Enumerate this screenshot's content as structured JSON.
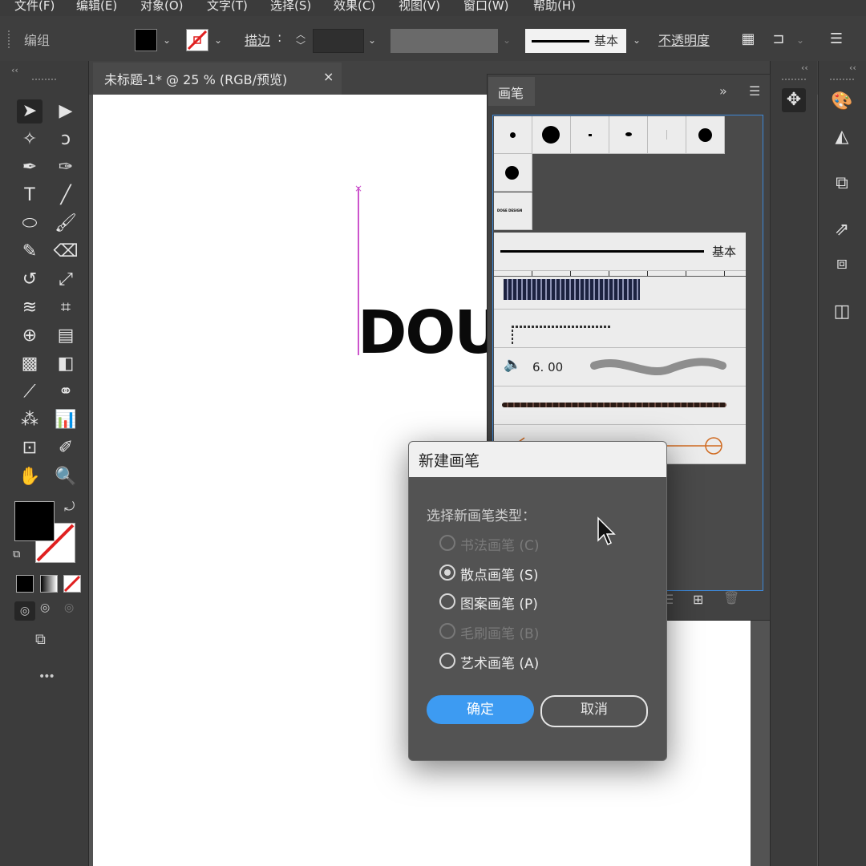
{
  "menu": [
    "文件(F)",
    "编辑(E)",
    "对象(O)",
    "文字(T)",
    "选择(S)",
    "效果(C)",
    "视图(V)",
    "窗口(W)",
    "帮助(H)"
  ],
  "control_bar": {
    "group_label": "编组",
    "stroke_label": "描边",
    "brush_label": "基本",
    "opacity_label": "不透明度"
  },
  "document_tab": {
    "title": "未标题-1* @ 25 % (RGB/预览)",
    "close_glyph": "×"
  },
  "artboard": {
    "text": "DOU"
  },
  "brush_panel": {
    "tab": "画笔",
    "basic_label": "基本",
    "size_value": "6. 00",
    "sample_text": "DOGE DESIGN"
  },
  "dialog": {
    "title": "新建画笔",
    "prompt": "选择新画笔类型：",
    "options": [
      {
        "label": "书法画笔 (C)",
        "enabled": false,
        "selected": false
      },
      {
        "label": "散点画笔 (S)",
        "enabled": true,
        "selected": true
      },
      {
        "label": "图案画笔 (P)",
        "enabled": true,
        "selected": false
      },
      {
        "label": "毛刷画笔 (B)",
        "enabled": false,
        "selected": false
      },
      {
        "label": "艺术画笔 (A)",
        "enabled": true,
        "selected": false
      }
    ],
    "ok_label": "确定",
    "cancel_label": "取消"
  },
  "colors": {
    "accent_blue": "#3d9bf2",
    "guide_magenta": "#cc55cc",
    "stroke_none_red": "#e02020"
  },
  "icons": {
    "more": "•••"
  }
}
